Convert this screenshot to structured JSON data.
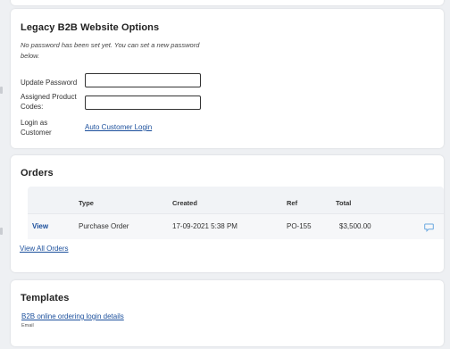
{
  "legacy": {
    "title": "Legacy B2B Website Options",
    "note": "No password has been set yet. You can set a new password below.",
    "update_password_label": "Update Password",
    "update_password_value": "",
    "assigned_codes_label": "Assigned Product Codes:",
    "assigned_codes_value": "",
    "login_as_label": "Login as Customer",
    "auto_login_link": "Auto Customer Login"
  },
  "orders": {
    "title": "Orders",
    "columns": {
      "type": "Type",
      "created": "Created",
      "ref": "Ref",
      "total": "Total"
    },
    "rows": [
      {
        "action": "View",
        "type": "Purchase Order",
        "created": "17-09-2021 5:38 PM",
        "ref": "PO-155",
        "total": "$3,500.00"
      }
    ],
    "view_all": "View All Orders"
  },
  "templates": {
    "title": "Templates",
    "items": [
      {
        "name": "B2B online ordering login details",
        "kind": "Email"
      }
    ]
  },
  "colors": {
    "link": "#1b4f9c",
    "icon": "#6aa8e0"
  },
  "icons": [
    "comment-icon"
  ]
}
